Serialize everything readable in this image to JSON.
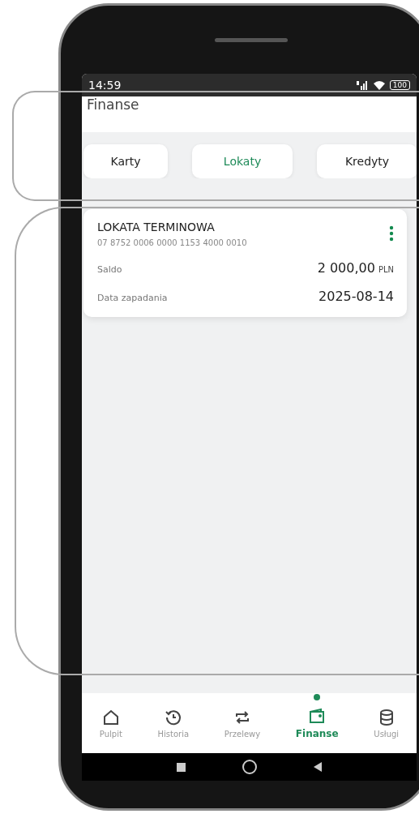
{
  "status_bar": {
    "time": "14:59",
    "battery": "100"
  },
  "header": {
    "title": "Finanse"
  },
  "tabs": [
    {
      "label": "Karty",
      "selected": false
    },
    {
      "label": "Lokaty",
      "selected": true
    },
    {
      "label": "Kredyty",
      "selected": false
    }
  ],
  "deposit_card": {
    "name": "LOKATA TERMINOWA",
    "account": "07 8752 0006 0000 1153 4000 0010",
    "rows": [
      {
        "label": "Saldo",
        "value": "2 000,00",
        "unit": "PLN"
      },
      {
        "label": "Data zapadania",
        "value": "2025-08-14"
      }
    ]
  },
  "bottom_nav": [
    {
      "label": "Pulpit",
      "kind": "home",
      "selected": false
    },
    {
      "label": "Historia",
      "kind": "history",
      "selected": false
    },
    {
      "label": "Przelewy",
      "kind": "transfer",
      "selected": false
    },
    {
      "label": "Finanse",
      "kind": "wallet",
      "selected": true
    },
    {
      "label": "Usługi",
      "kind": "database",
      "selected": false
    }
  ]
}
